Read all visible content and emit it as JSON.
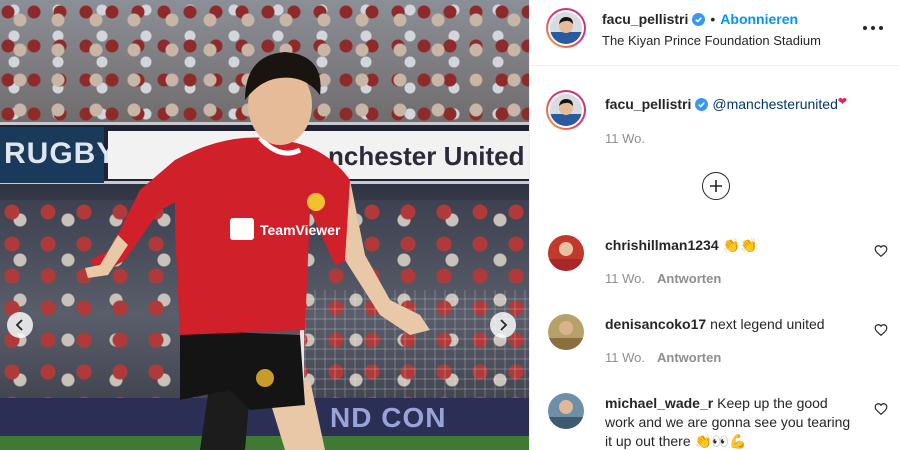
{
  "post": {
    "username": "facu_pellistri",
    "follow_label": "Abonnieren",
    "location": "The Kiyan Prince Foundation Stadium",
    "caption": {
      "username": "facu_pellistri",
      "text": "@manchesterunited",
      "emoji": "❤",
      "time": "11 Wo."
    }
  },
  "photo": {
    "banner_left_text": "RUGBY",
    "banner_right_text": "nchester United",
    "ad_text": "ND CON"
  },
  "comments": [
    {
      "username": "chrishillman1234",
      "text": "👏👏",
      "time": "11 Wo.",
      "reply_label": "Antworten",
      "avatar_color": "#c0392b"
    },
    {
      "username": "denisancoko17",
      "text": "next legend united",
      "time": "11 Wo.",
      "reply_label": "Antworten",
      "avatar_color": "#b8a06a"
    },
    {
      "username": "michael_wade_r",
      "text": "Keep up the good work and we are gonna see you tearing it up out there 👏👀💪",
      "avatar_color": "#6e8fa8"
    }
  ],
  "icons": {
    "verified": "verified-badge-icon",
    "more": "more-options-icon",
    "load_more": "load-more-comments-icon",
    "like": "heart-outline-icon",
    "prev": "chevron-left-icon",
    "next": "chevron-right-icon"
  },
  "colors": {
    "accent": "#0095f6",
    "verified": "#3897f0",
    "mention": "#00376b",
    "muted": "#8e8e8e",
    "jersey_red": "#d0202a"
  }
}
